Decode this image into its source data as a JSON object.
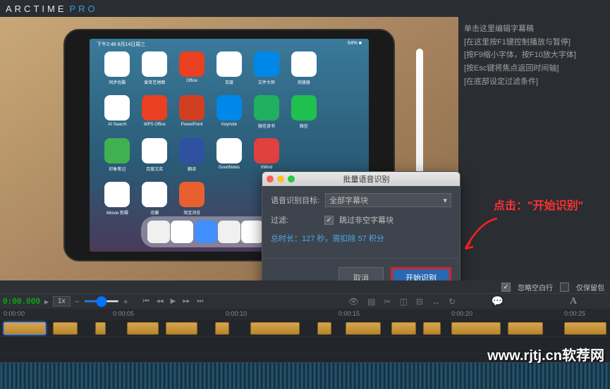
{
  "app": {
    "name_a": "ARCTIME",
    "name_b": "PRO"
  },
  "ipad": {
    "status_left": "下午2:48 8月14日周三",
    "status_right": "64% ■",
    "apps": [
      {
        "label": "同步优酷",
        "bg": "#fff"
      },
      {
        "label": "爱奇艺地图",
        "bg": "#fff"
      },
      {
        "label": "Office",
        "bg": "#e84020"
      },
      {
        "label": "百度",
        "bg": "#fff"
      },
      {
        "label": "文件大师",
        "bg": "#0088e8"
      },
      {
        "label": "测速器",
        "bg": "#fff"
      },
      {
        "label": "",
        "bg": "#transparent"
      },
      {
        "label": "AI Search",
        "bg": "#fff"
      },
      {
        "label": "WPS Office",
        "bg": "#e84020"
      },
      {
        "label": "PowerPoint",
        "bg": "#d04020"
      },
      {
        "label": "Keynote",
        "bg": "#0088e8"
      },
      {
        "label": "微信读书",
        "bg": "#20b060"
      },
      {
        "label": "微信",
        "bg": "#20c050"
      },
      {
        "label": "",
        "bg": "#transparent"
      },
      {
        "label": "印象笔记",
        "bg": "#40b050"
      },
      {
        "label": "百度文库",
        "bg": "#fff"
      },
      {
        "label": "翻译",
        "bg": "#3050a0"
      },
      {
        "label": "GoodNotes",
        "bg": "#fff"
      },
      {
        "label": "XMind",
        "bg": "#e04040"
      },
      {
        "label": "",
        "bg": "transparent"
      },
      {
        "label": "",
        "bg": "transparent"
      },
      {
        "label": "iMovie 剪辑",
        "bg": "#fff"
      },
      {
        "label": "花瓣",
        "bg": "#fff"
      },
      {
        "label": "淘宝浏览",
        "bg": "#e86030"
      }
    ],
    "dock": [
      {
        "bg": "#f0f0f0"
      },
      {
        "bg": "#fff"
      },
      {
        "bg": "#4090ff"
      },
      {
        "bg": "#f0f0f0"
      },
      {
        "bg": "#fff"
      },
      {
        "bg": "#303030"
      },
      {
        "bg": "#505050"
      }
    ]
  },
  "dialog": {
    "title": "批量语音识别",
    "target_label": "语音识别目标:",
    "target_value": "全部字幕块",
    "filter_label": "过滤:",
    "skip_empty": "跳过非空字幕块",
    "duration": "总时长：127 秒，需扣除 57 积分",
    "cancel": "取消",
    "start": "开始识别"
  },
  "hints": [
    "单击这里编辑字幕稿",
    "[在这里按F1键控制播放与暂停]",
    "[按F9缩小字体，按F10放大字体]",
    "[按Esc键将焦点返回时间轴]",
    "[在底部设定过滤条件]"
  ],
  "callout": "点击：\"开始识别\"",
  "options": {
    "ignore_blank": "忽略空白行",
    "keep_package": "仅保留包"
  },
  "timeline": {
    "timecode": "0:00.000",
    "zoom": "1x",
    "marks": [
      "0:00:00",
      "0:00:05",
      "0:00:10",
      "0:00:15",
      "0:00:20",
      "0:00:25"
    ]
  },
  "watermark": "www.rjtj.cn软荐网"
}
